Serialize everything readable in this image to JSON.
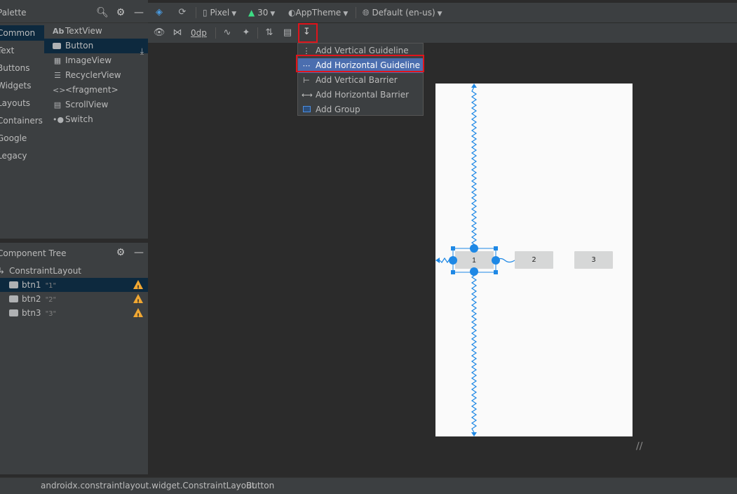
{
  "palette": {
    "title": "Palette",
    "categories": [
      "Common",
      "Text",
      "Buttons",
      "Widgets",
      "Layouts",
      "Containers",
      "Google",
      "Legacy"
    ],
    "active_category": "Common",
    "widgets": [
      {
        "label": "TextView",
        "icon": "Ab"
      },
      {
        "label": "Button",
        "icon": "button-icon"
      },
      {
        "label": "ImageView",
        "icon": "image-icon"
      },
      {
        "label": "RecyclerView",
        "icon": "list-icon"
      },
      {
        "label": "<fragment>",
        "icon": "<>"
      },
      {
        "label": "ScrollView",
        "icon": "scroll-icon"
      },
      {
        "label": "Switch",
        "icon": "switch-icon"
      }
    ],
    "selected_widget": "Button"
  },
  "component_tree": {
    "title": "Component Tree",
    "root": "ConstraintLayout",
    "items": [
      {
        "name": "btn1",
        "value": "\"1\""
      },
      {
        "name": "btn2",
        "value": "\"2\""
      },
      {
        "name": "btn3",
        "value": "\"3\""
      }
    ]
  },
  "toolbar": {
    "device": "Pixel",
    "api": "30",
    "theme": "AppTheme",
    "locale": "Default (en-us)",
    "margin": "0dp"
  },
  "guideline_menu": {
    "items": [
      {
        "label": "Add Vertical Guideline",
        "icon": "vertical-guideline-icon"
      },
      {
        "label": "Add Horizontal Guideline",
        "icon": "horizontal-guideline-icon"
      },
      {
        "label": "Add Vertical Barrier",
        "icon": "vertical-barrier-icon"
      },
      {
        "label": "Add Horizontal Barrier",
        "icon": "horizontal-barrier-icon"
      },
      {
        "label": "Add Group",
        "icon": "group-icon"
      }
    ],
    "highlighted": "Add Horizontal Guideline"
  },
  "canvas": {
    "buttons": [
      "1",
      "2",
      "3"
    ],
    "selected": "1"
  },
  "breadcrumb": {
    "path": "androidx.constraintlayout.widget.ConstraintLayout",
    "current": "Button"
  },
  "colors": {
    "accent": "#1e88e5",
    "highlight_box": "#e0141b",
    "warning": "#f0a732",
    "menu_highlight": "#4b6eaf"
  }
}
